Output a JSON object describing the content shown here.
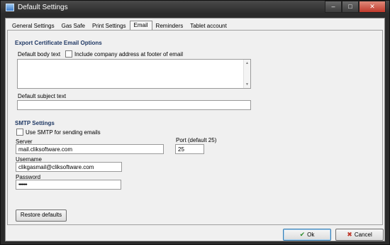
{
  "window": {
    "title": "Default Settings"
  },
  "tabs": [
    {
      "label": "General Settings"
    },
    {
      "label": "Gas Safe"
    },
    {
      "label": "Print Settings"
    },
    {
      "label": "Email"
    },
    {
      "label": "Reminders"
    },
    {
      "label": "Tablet account"
    }
  ],
  "active_tab": "Email",
  "export": {
    "section_title": "Export Certificate Email Options",
    "body_label": "Default body text",
    "include_address_label": "Include  company address at footer of email",
    "include_address_checked": false,
    "body_text": "",
    "subject_label": "Default subject text",
    "subject_value": ""
  },
  "smtp": {
    "section_title": "SMTP Settings",
    "use_smtp_label": "Use SMTP for sending emails",
    "use_smtp_checked": false,
    "server_label": "Server",
    "server_value": "mail.cliksoftware.com",
    "port_label": "Port (default 25)",
    "port_value": "25",
    "username_label": "Username",
    "username_value": "clikgasmail@cliksoftware.com",
    "password_label": "Password",
    "password_value": "••••••••"
  },
  "buttons": {
    "restore": "Restore defaults",
    "ok": "Ok",
    "cancel": "Cancel"
  },
  "icons": {
    "ok": "check-icon",
    "cancel": "cross-icon",
    "minimize": "minimize-icon",
    "maximize": "maximize-icon",
    "close": "close-icon"
  }
}
